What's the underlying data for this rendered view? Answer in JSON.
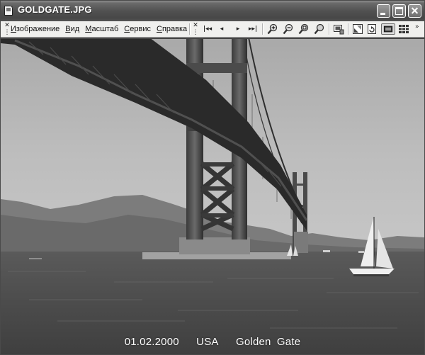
{
  "window": {
    "title": "GOLDGATE.JPG"
  },
  "menu": {
    "items": [
      {
        "label": "Изображение",
        "underline": "И",
        "rest": "зображение"
      },
      {
        "label": "Вид",
        "underline": "В",
        "rest": "ид"
      },
      {
        "label": "Масштаб",
        "underline": "М",
        "rest": "асштаб"
      },
      {
        "label": "Сервис",
        "underline": "С",
        "rest": "ервис"
      },
      {
        "label": "Справка",
        "underline": "С",
        "rest": "правка"
      }
    ]
  },
  "toolbar": {
    "icons": [
      "first-image-icon",
      "previous-image-icon",
      "next-image-icon",
      "last-image-icon",
      "zoom-in-icon",
      "zoom-out-icon",
      "zoom-fit-icon",
      "zoom-actual-icon",
      "image-info-icon",
      "fit-window-icon",
      "rotate-icon",
      "full-view-icon",
      "thumbnails-icon"
    ]
  },
  "image": {
    "caption_date": "01.02.2000",
    "caption_country": "USA",
    "caption_title": "Golden Gate"
  }
}
